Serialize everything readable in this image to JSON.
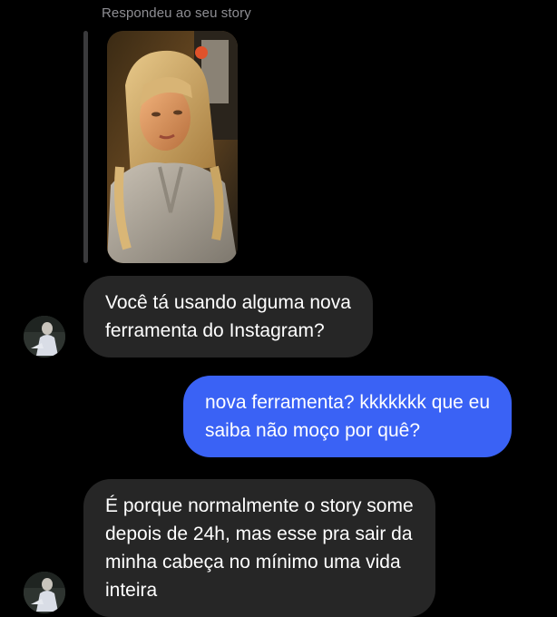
{
  "story_reply": {
    "label": "Respondeu ao seu story",
    "thumbnail_alt": "story-photo"
  },
  "messages": [
    {
      "direction": "incoming",
      "text": "Você tá usando alguma nova\nferramenta do Instagram?"
    },
    {
      "direction": "outgoing",
      "text": "nova ferramenta? kkkkkkk que eu\nsaiba não moço por quê?"
    },
    {
      "direction": "incoming",
      "text": "É porque normalmente o story some\ndepois de 24h, mas esse pra sair da\nminha cabeça no mínimo uma vida\ninteira"
    }
  ],
  "colors": {
    "background": "#000000",
    "incoming_bubble": "#262626",
    "outgoing_bubble": "#3a62f5",
    "meta_text": "#8e8e93"
  }
}
